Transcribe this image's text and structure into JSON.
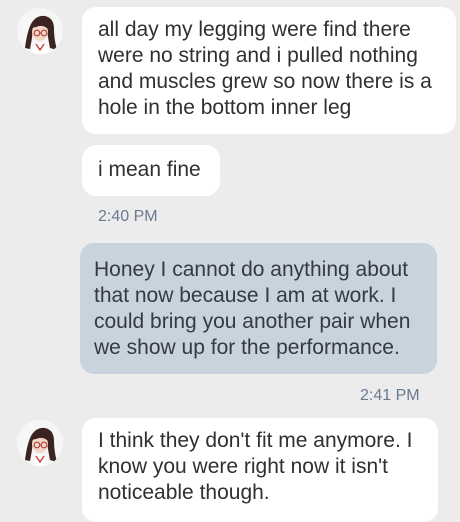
{
  "conversation": {
    "messages": [
      {
        "sender": "contact",
        "text": "all day my legging were find there were no string and i pulled nothing and muscles grew so now there is a hole in the bottom inner leg"
      },
      {
        "sender": "contact",
        "text": "i mean fine"
      },
      {
        "sender": "me",
        "text": "Honey I cannot do anything about that now because I am at work. I could bring you another pair when we show up for the performance."
      },
      {
        "sender": "contact",
        "text": "I think they don't fit me anymore. I know you were right now it isn't noticeable though."
      }
    ],
    "timestamps": [
      "2:40 PM",
      "2:41 PM"
    ]
  },
  "colors": {
    "background": "#ececec",
    "incoming_bubble": "#ffffff",
    "outgoing_bubble": "#c9d3dd",
    "timestamp_text": "#6a7a90"
  },
  "icons": {
    "avatar": "contact-avatar-illustration"
  }
}
